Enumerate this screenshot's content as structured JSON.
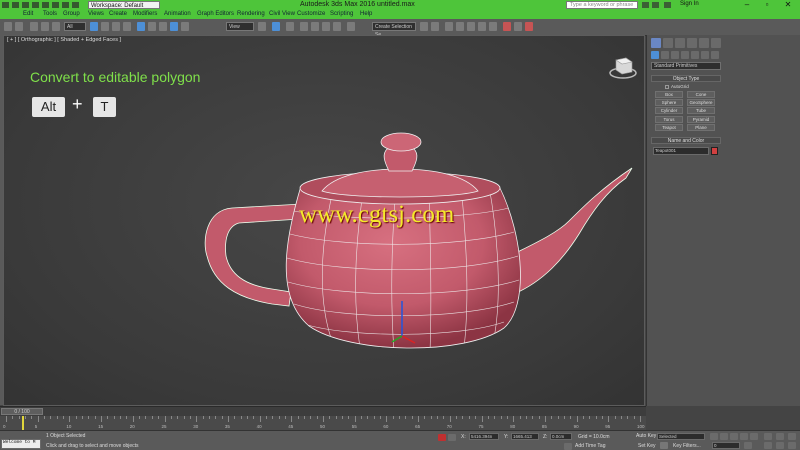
{
  "titlebar": {
    "workspace": "Workspace: Default",
    "title": "Autodesk 3ds Max 2016     untitled.max",
    "search_placeholder": "Type a keyword or phrase",
    "sign_in": "Sign In",
    "accent": "#4ec53a"
  },
  "menu": [
    "Edit",
    "Tools",
    "Group",
    "Views",
    "Create",
    "Modifiers",
    "Animation",
    "Graph Editors",
    "Rendering",
    "Civil View",
    "Customize",
    "Scripting",
    "Help"
  ],
  "toolbar": {
    "filter": "All",
    "ref_coord": "View",
    "selection_set": "Create Selection Se"
  },
  "viewport": {
    "label": "[ + ] [ Orthographic ] [ Shaded + Edged Faces ]",
    "heading": "Convert to editable polygon",
    "key1": "Alt",
    "plus": "+",
    "key2": "T",
    "watermark": "www.cgtsj.com",
    "heading_color": "#7fe04a",
    "teapot_color": "#c85a6a"
  },
  "command_panel": {
    "category": "Standard Primitives",
    "object_type_title": "Object Type",
    "autogrid": "AutoGrid",
    "buttons": [
      "Box",
      "Cone",
      "Sphere",
      "GeoSphere",
      "Cylinder",
      "Tube",
      "Torus",
      "Pyramid",
      "Teapot",
      "Plane"
    ],
    "name_color_title": "Name and Color",
    "object_name": "Teapot001",
    "object_color": "#d04040"
  },
  "timeline": {
    "slider": "0 / 100",
    "ticks": [
      "0",
      "5",
      "10",
      "15",
      "20",
      "25",
      "30",
      "35",
      "40",
      "45",
      "50",
      "55",
      "60",
      "65",
      "70",
      "75",
      "80",
      "85",
      "90",
      "95",
      "100"
    ]
  },
  "status": {
    "maxscript": "Welcome to M",
    "selection": "1 Object Selected",
    "prompt": "Click and drag to select and move objects",
    "x": "5416.394n",
    "y": "1665.413",
    "z": "0.0cm",
    "grid": "Grid = 10.0cm",
    "add_time_tag": "Add Time Tag",
    "auto_key": "Auto Key",
    "selected": "Selected",
    "set_key": "Set Key",
    "key_filters": "Key Filters...",
    "frame": "0"
  }
}
